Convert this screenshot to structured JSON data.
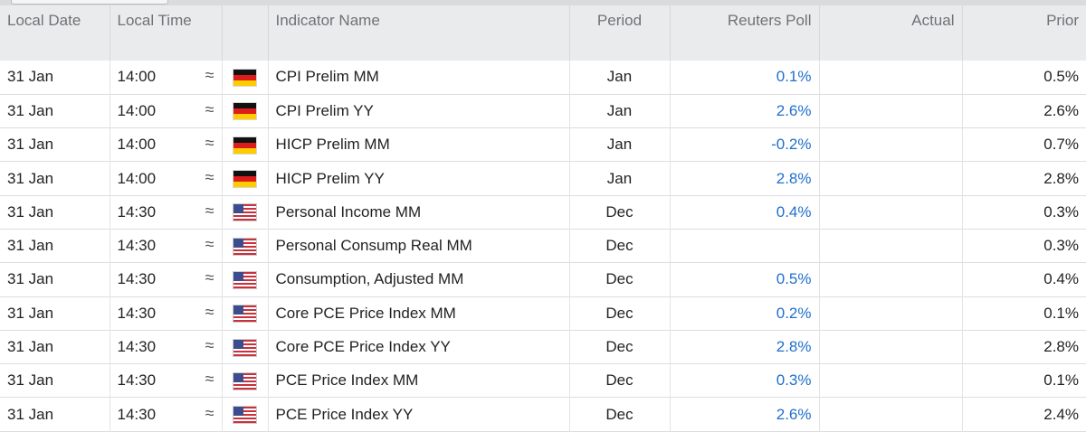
{
  "headers": {
    "local_date": "Local Date",
    "local_time": "Local Time",
    "indicator": "Indicator Name",
    "period": "Period",
    "poll": "Reuters Poll",
    "actual": "Actual",
    "prior": "Prior"
  },
  "approx_symbol": "≈",
  "rows": [
    {
      "date": "31 Jan",
      "time": "14:00",
      "flag": "germany-flag-icon",
      "name": "CPI Prelim MM",
      "period": "Jan",
      "poll": "0.1%",
      "actual": "",
      "prior": "0.5%"
    },
    {
      "date": "31 Jan",
      "time": "14:00",
      "flag": "germany-flag-icon",
      "name": "CPI Prelim YY",
      "period": "Jan",
      "poll": "2.6%",
      "actual": "",
      "prior": "2.6%"
    },
    {
      "date": "31 Jan",
      "time": "14:00",
      "flag": "germany-flag-icon",
      "name": "HICP Prelim MM",
      "period": "Jan",
      "poll": "-0.2%",
      "actual": "",
      "prior": "0.7%"
    },
    {
      "date": "31 Jan",
      "time": "14:00",
      "flag": "germany-flag-icon",
      "name": "HICP Prelim YY",
      "period": "Jan",
      "poll": "2.8%",
      "actual": "",
      "prior": "2.8%"
    },
    {
      "date": "31 Jan",
      "time": "14:30",
      "flag": "us-flag-icon",
      "name": "Personal Income MM",
      "period": "Dec",
      "poll": "0.4%",
      "actual": "",
      "prior": "0.3%"
    },
    {
      "date": "31 Jan",
      "time": "14:30",
      "flag": "us-flag-icon",
      "name": "Personal Consump Real MM",
      "period": "Dec",
      "poll": "",
      "actual": "",
      "prior": "0.3%"
    },
    {
      "date": "31 Jan",
      "time": "14:30",
      "flag": "us-flag-icon",
      "name": "Consumption, Adjusted MM",
      "period": "Dec",
      "poll": "0.5%",
      "actual": "",
      "prior": "0.4%"
    },
    {
      "date": "31 Jan",
      "time": "14:30",
      "flag": "us-flag-icon",
      "name": "Core PCE Price Index MM",
      "period": "Dec",
      "poll": "0.2%",
      "actual": "",
      "prior": "0.1%"
    },
    {
      "date": "31 Jan",
      "time": "14:30",
      "flag": "us-flag-icon",
      "name": "Core PCE Price Index YY",
      "period": "Dec",
      "poll": "2.8%",
      "actual": "",
      "prior": "2.8%"
    },
    {
      "date": "31 Jan",
      "time": "14:30",
      "flag": "us-flag-icon",
      "name": "PCE Price Index MM",
      "period": "Dec",
      "poll": "0.3%",
      "actual": "",
      "prior": "0.1%"
    },
    {
      "date": "31 Jan",
      "time": "14:30",
      "flag": "us-flag-icon",
      "name": "PCE Price Index YY",
      "period": "Dec",
      "poll": "2.6%",
      "actual": "",
      "prior": "2.4%"
    }
  ],
  "colors": {
    "header_bg": "#eaebec",
    "poll_text": "#1f6fcf",
    "row_border": "#dcdde0"
  }
}
